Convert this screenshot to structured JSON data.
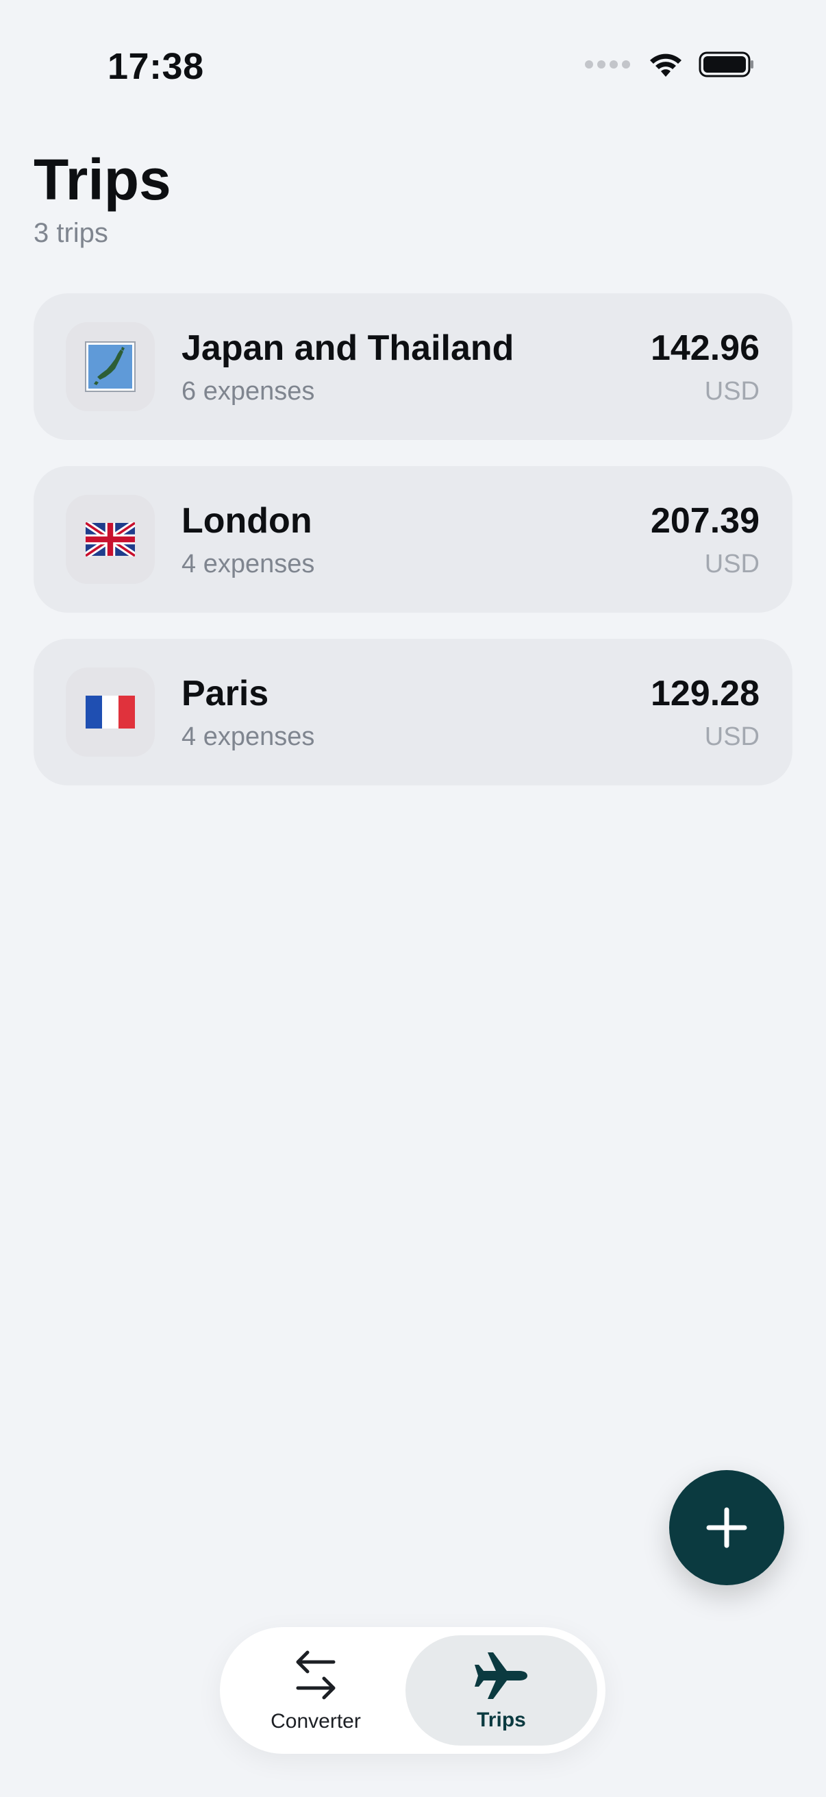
{
  "status_bar": {
    "time": "17:38"
  },
  "header": {
    "title": "Trips",
    "subtitle": "3 trips"
  },
  "trips": [
    {
      "name": "Japan and Thailand",
      "expenses": "6 expenses",
      "amount": "142.96",
      "currency": "USD",
      "icon": "japan-map-icon"
    },
    {
      "name": "London",
      "expenses": "4 expenses",
      "amount": "207.39",
      "currency": "USD",
      "icon": "uk-flag-icon"
    },
    {
      "name": "Paris",
      "expenses": "4 expenses",
      "amount": "129.28",
      "currency": "USD",
      "icon": "france-flag-icon"
    }
  ],
  "tab_bar": {
    "converter_label": "Converter",
    "trips_label": "Trips"
  },
  "colors": {
    "background": "#f2f4f7",
    "card": "#e8eaee",
    "accent": "#0b3a40",
    "muted_text": "#7f858f"
  }
}
